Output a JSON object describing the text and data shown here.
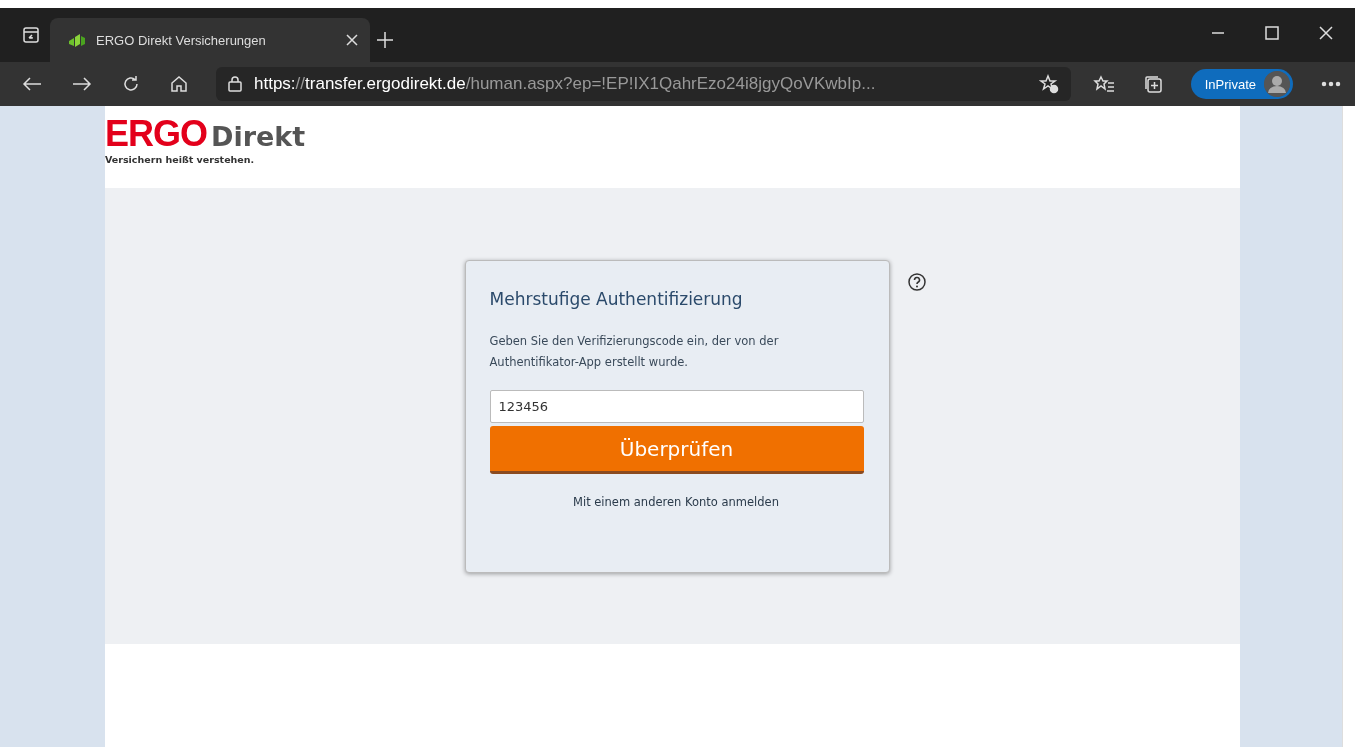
{
  "browser": {
    "tabs": [
      {
        "title": "ERGO Direkt Versicherungen",
        "selected": true
      }
    ],
    "url_parts": [
      {
        "text": "https:",
        "muted": false
      },
      {
        "text": "//",
        "muted": true
      },
      {
        "text": "transfer.ergodirekt.de",
        "muted": false
      },
      {
        "text": "/human.aspx?ep=!EP!IX1QahrEzo24i8jgyQoVKwbIp...",
        "muted": true
      }
    ],
    "profile_label": "InPrivate"
  },
  "header": {
    "logo_main": "ERGO",
    "logo_sub": "Direkt",
    "tagline": "Versichern heißt verstehen."
  },
  "card": {
    "title": "Mehrstufige Authentifizierung",
    "instructions": "Geben Sie den Verifizierungscode ein, der von der Authentifikator-App erstellt wurde.",
    "code_field": {
      "value": "123456"
    },
    "submit_button": "Überprüfen",
    "alt_link": "Mit einem anderen Konto anmelden"
  }
}
